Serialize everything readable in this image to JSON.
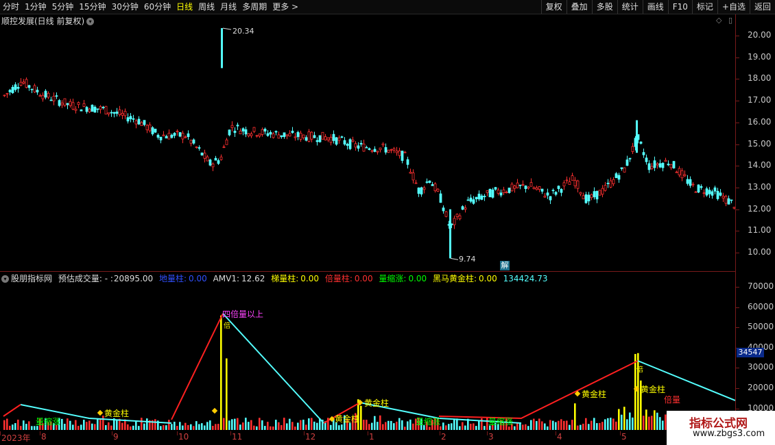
{
  "toolbar": {
    "periods": [
      "分时",
      "1分钟",
      "5分钟",
      "15分钟",
      "30分钟",
      "60分钟",
      "日线",
      "周线",
      "月线",
      "多周期",
      "更多 >"
    ],
    "active_period": "日线",
    "tools": [
      "复权",
      "叠加",
      "多股",
      "统计",
      "画线",
      "F10",
      "标记",
      "+自选",
      "返回"
    ]
  },
  "main_chart": {
    "title": "顺控发展(日线 前复权)",
    "high_label": "20.34",
    "low_label": "9.74",
    "jie": "解",
    "y_ticks": [
      "20.00",
      "19.00",
      "18.00",
      "17.00",
      "16.00",
      "15.00",
      "14.00",
      "13.00",
      "12.00",
      "11.00",
      "10.00"
    ],
    "y_range": [
      9.5,
      20.5
    ]
  },
  "indicator": {
    "name": "股朋指标网",
    "est_vol_label": "预估成交量: - :",
    "est_vol_value": "20895.00",
    "dlz_label": "地量柱:",
    "dlz_value": "0.00",
    "amv_label": "AMV1:",
    "amv_value": "12.62",
    "tlz_label": "梯量柱:",
    "tlz_value": "0.00",
    "blz_label": "倍量柱:",
    "blz_value": "0.00",
    "lsz_label": "量缩涨:",
    "lsz_value": "0.00",
    "hm_label": "黑马黄金柱:",
    "hm_value": "0.00",
    "last_value": "134424.73",
    "y_ticks": [
      "70000",
      "60000",
      "50000",
      "40000",
      "30000",
      "20000",
      "10000"
    ],
    "badge": "34547",
    "annotations": {
      "four_times": "四倍量以上",
      "gold": "黄金柱",
      "shrink": "量缩涨",
      "bei": "倍",
      "bei_liang": "倍量"
    }
  },
  "date_axis": [
    "2023年",
    "8",
    "9",
    "10",
    "11",
    "12",
    "1",
    "2",
    "3",
    "4",
    "5"
  ],
  "watermark": {
    "main": "指标公式网",
    "sub": "www.zbgs3.com"
  },
  "colors": {
    "up": "#ff3030",
    "down": "#54ffff",
    "axis": "#7a1a1a",
    "yellow": "#ffff00"
  }
}
